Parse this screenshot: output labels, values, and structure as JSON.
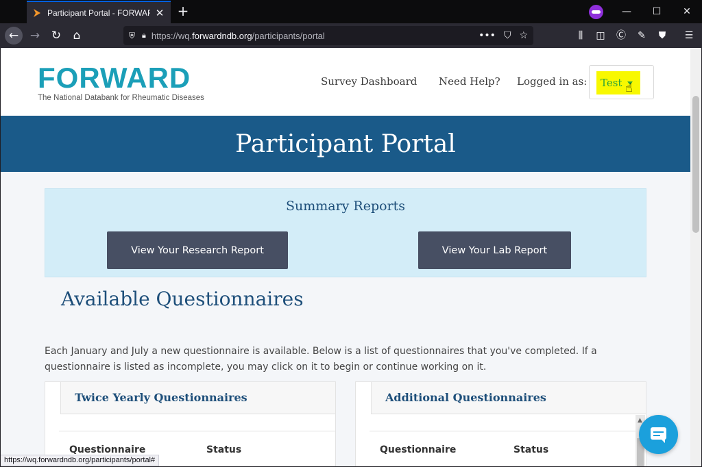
{
  "browser": {
    "tab_title": "Participant Portal - FORWARD",
    "url_prefix": "https://wq.",
    "url_host": "forwardndb.org",
    "url_path": "/participants/portal",
    "status_url": "https://wq.forwardndb.org/participants/portal#"
  },
  "header": {
    "logo_word": "FORWARD",
    "logo_tagline": "The National Databank for Rheumatic Diseases",
    "nav": {
      "survey_dashboard": "Survey Dashboard",
      "need_help": "Need Help?",
      "logged_in_label": "Logged in as:",
      "user_name": "Test"
    }
  },
  "banner": {
    "title": "Participant Portal"
  },
  "reports": {
    "title": "Summary Reports",
    "research_button": "View Your Research Report",
    "lab_button": "View Your Lab Report"
  },
  "questionnaires": {
    "title": "Available Questionnaires",
    "intro": "Each January and July a new questionnaire is available. Below is a list of questionnaires that you've completed. If a questionnaire is listed as incomplete, you may click on it to begin or continue working on it.",
    "twice_yearly": {
      "title": "Twice Yearly Questionnaires",
      "col_questionnaire": "Questionnaire",
      "col_status": "Status"
    },
    "additional": {
      "title": "Additional Questionnaires",
      "col_questionnaire": "Questionnaire",
      "col_status": "Status"
    }
  },
  "colors": {
    "brand_teal": "#1b9fb8",
    "brand_orange": "#f3962b",
    "banner_blue": "#1a5a89",
    "heading_blue": "#1e4f7a",
    "button_slate": "#474f63",
    "chat_blue": "#1ba0dc"
  }
}
